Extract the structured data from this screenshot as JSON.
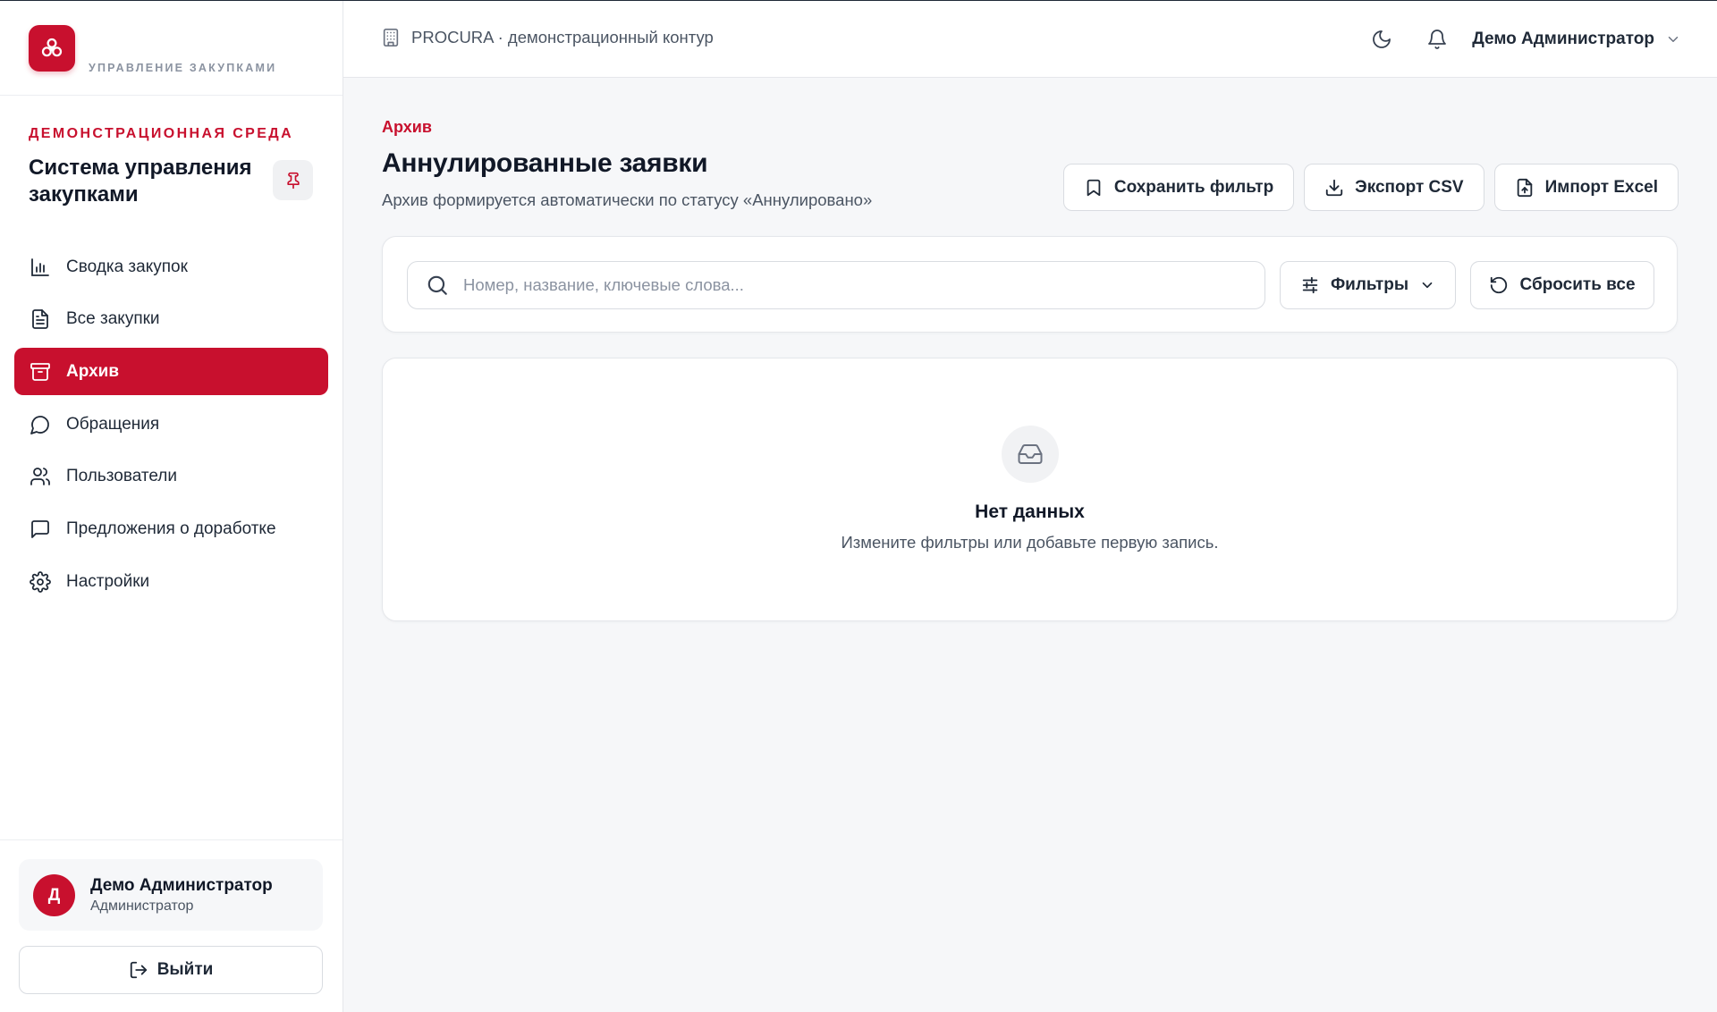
{
  "sidebar": {
    "logo_subtitle": "УПРАВЛЕНИЕ ЗАКУПКАМИ",
    "env_label": "ДЕМОНСТРАЦИОННАЯ СРЕДА",
    "system_title": "Система управления закупками",
    "items": [
      {
        "label": "Сводка закупок",
        "icon": "bar-chart-icon",
        "active": false
      },
      {
        "label": "Все закупки",
        "icon": "document-icon",
        "active": false
      },
      {
        "label": "Архив",
        "icon": "archive-icon",
        "active": true
      },
      {
        "label": "Обращения",
        "icon": "message-circle-icon",
        "active": false
      },
      {
        "label": "Пользователи",
        "icon": "users-icon",
        "active": false
      },
      {
        "label": "Предложения о доработке",
        "icon": "message-square-icon",
        "active": false
      },
      {
        "label": "Настройки",
        "icon": "gear-icon",
        "active": false
      }
    ],
    "user": {
      "initial": "Д",
      "name": "Демо Администратор",
      "role": "Администратор"
    },
    "logout_label": "Выйти"
  },
  "topbar": {
    "context": "PROCURA · демонстрационный контур",
    "user_name": "Демо Администратор"
  },
  "page": {
    "breadcrumb": "Архив",
    "title": "Аннулированные заявки",
    "subtitle": "Архив формируется автоматически по статусу «Аннулировано»",
    "actions": {
      "save_filter": "Сохранить фильтр",
      "export_csv": "Экспорт CSV",
      "import_excel": "Импорт Excel"
    },
    "search": {
      "placeholder": "Номер, название, ключевые слова...",
      "value": ""
    },
    "filters_label": "Фильтры",
    "reset_label": "Сбросить все",
    "empty": {
      "title": "Нет данных",
      "subtitle": "Измените фильтры или добавьте первую запись."
    }
  },
  "colors": {
    "accent": "#c8102e",
    "background": "#f6f7f9",
    "surface": "#ffffff",
    "border": "#d9dce1",
    "text": "#111827",
    "muted": "#4b5563"
  }
}
